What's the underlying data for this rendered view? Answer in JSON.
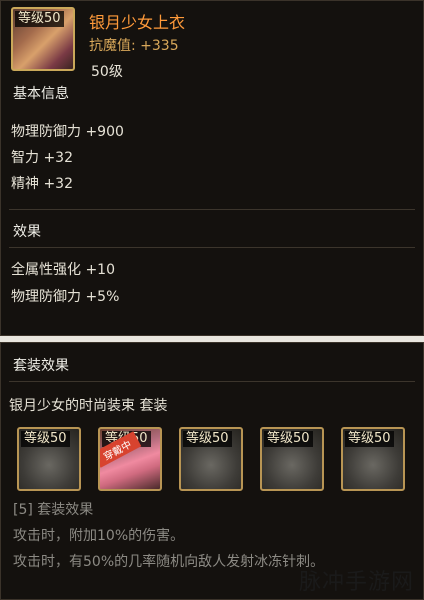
{
  "item": {
    "level_tag": "等级50",
    "name": "银月少女上衣",
    "resist": "抗魔值: +335",
    "level": "50级"
  },
  "basic": {
    "title": "基本信息",
    "stats": [
      "物理防御力 +900",
      "智力 +32",
      "精神 +32"
    ]
  },
  "effects": {
    "title": "效果",
    "stats": [
      "全属性强化 +10",
      "物理防御力 +5%"
    ]
  },
  "set": {
    "title": "套装效果",
    "name": "银月少女的时尚装束 套装",
    "pieces": [
      {
        "level_tag": "等级50",
        "equipped": false
      },
      {
        "level_tag": "等级50",
        "equipped": true,
        "badge": "穿戴中"
      },
      {
        "level_tag": "等级50",
        "equipped": false
      },
      {
        "level_tag": "等级50",
        "equipped": false
      },
      {
        "level_tag": "等级50",
        "equipped": false
      }
    ],
    "bonus_title": "[5] 套装效果",
    "bonuses": [
      "攻击时，附加10%的伤害。",
      "攻击时，有50%的几率随机向敌人发射冰冻针刺。"
    ]
  },
  "watermark": "脉冲手游网",
  "colors": {
    "accent": "#ff9a3a",
    "gold": "#caa85a",
    "panel": "#14110e"
  }
}
